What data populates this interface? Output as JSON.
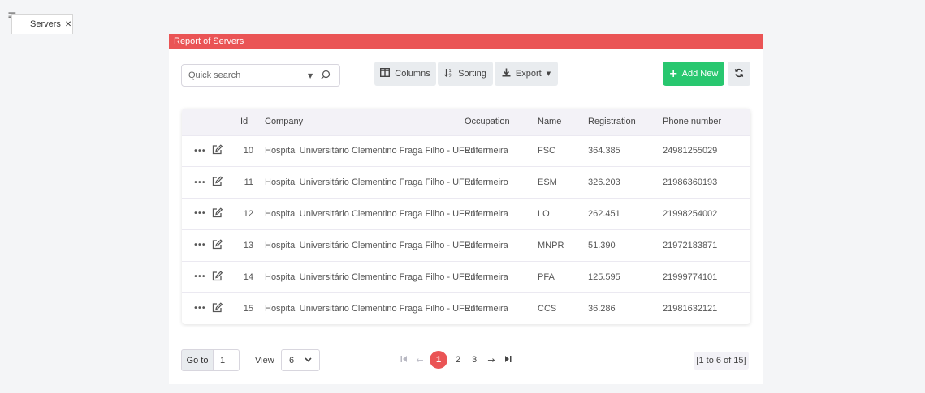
{
  "tabbar": {
    "menu_icon": "hamburger-icon",
    "tab_label": "Servers",
    "tab_close": "✕"
  },
  "panel": {
    "title": "Report of Servers"
  },
  "toolbar": {
    "search_placeholder": "Quick search",
    "columns_label": "Columns",
    "sorting_label": "Sorting",
    "export_label": "Export",
    "add_label": "Add New"
  },
  "table": {
    "columns": [
      "Id",
      "Company",
      "Occupation",
      "Name",
      "Registration",
      "Phone number"
    ],
    "rows": [
      {
        "id": "10",
        "company": "Hospital Universitário Clementino Fraga Filho - UFRJ",
        "occupation": "Enfermeira",
        "name": "FSC",
        "registration": "364.385",
        "phone": "24981255029"
      },
      {
        "id": "11",
        "company": "Hospital Universitário Clementino Fraga Filho - UFRJ",
        "occupation": "Enfermeiro",
        "name": "ESM",
        "registration": "326.203",
        "phone": "21986360193"
      },
      {
        "id": "12",
        "company": "Hospital Universitário Clementino Fraga Filho - UFRJ",
        "occupation": "Enfermeira",
        "name": "LO",
        "registration": "262.451",
        "phone": "21998254002"
      },
      {
        "id": "13",
        "company": "Hospital Universitário Clementino Fraga Filho - UFRJ",
        "occupation": "Enfermeira",
        "name": "MNPR",
        "registration": "51.390",
        "phone": "21972183871"
      },
      {
        "id": "14",
        "company": "Hospital Universitário Clementino Fraga Filho - UFRJ",
        "occupation": "Enfermeira",
        "name": "PFA",
        "registration": "125.595",
        "phone": "21999774101"
      },
      {
        "id": "15",
        "company": "Hospital Universitário Clementino Fraga Filho - UFRJ",
        "occupation": "Enfermeira",
        "name": "CCS",
        "registration": "36.286",
        "phone": "21981632121"
      }
    ]
  },
  "footer": {
    "goto_label": "Go to",
    "goto_value": "1",
    "view_label": "View",
    "view_value": "6",
    "pages": [
      "1",
      "2",
      "3"
    ],
    "current_page": "1",
    "range_text": "[1 to 6 of 15]"
  },
  "colors": {
    "header_red": "#ea5455",
    "add_green": "#28c76f",
    "current_page": "#ea5455"
  }
}
